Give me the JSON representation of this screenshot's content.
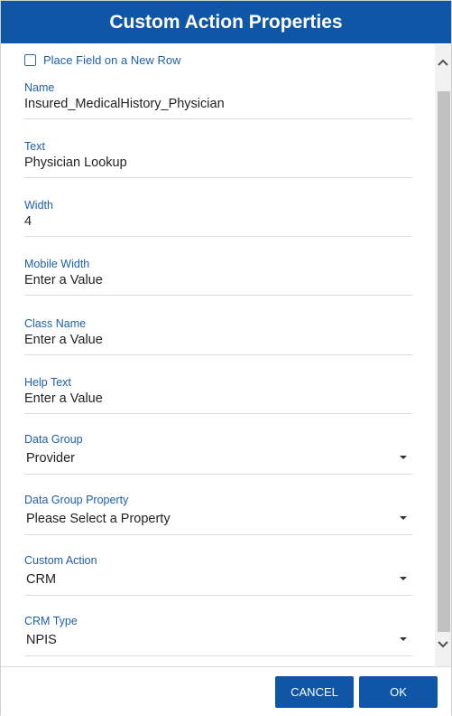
{
  "dialog": {
    "title": "Custom Action Properties",
    "new_row_checkbox": {
      "label": "Place Field on a New Row",
      "checked": false
    },
    "fields": [
      {
        "label": "Name",
        "value": "Insured_MedicalHistory_Physician"
      },
      {
        "label": "Text",
        "value": "Physician Lookup"
      },
      {
        "label": "Width",
        "value": "4"
      },
      {
        "label": "Mobile Width",
        "value": "Enter a Value"
      },
      {
        "label": "Class Name",
        "value": "Enter a Value"
      },
      {
        "label": "Help Text",
        "value": "Enter a Value"
      }
    ],
    "selects": [
      {
        "label": "Data Group",
        "value": "Provider"
      },
      {
        "label": "Data Group Property",
        "value": "Please Select a Property"
      },
      {
        "label": "Custom Action",
        "value": "CRM"
      },
      {
        "label": "CRM Type",
        "value": "NPIS"
      }
    ],
    "buttons": {
      "cancel": "CANCEL",
      "ok": "OK"
    }
  },
  "colors": {
    "accent": "#0f57a6",
    "label": "#1f5fa8"
  }
}
